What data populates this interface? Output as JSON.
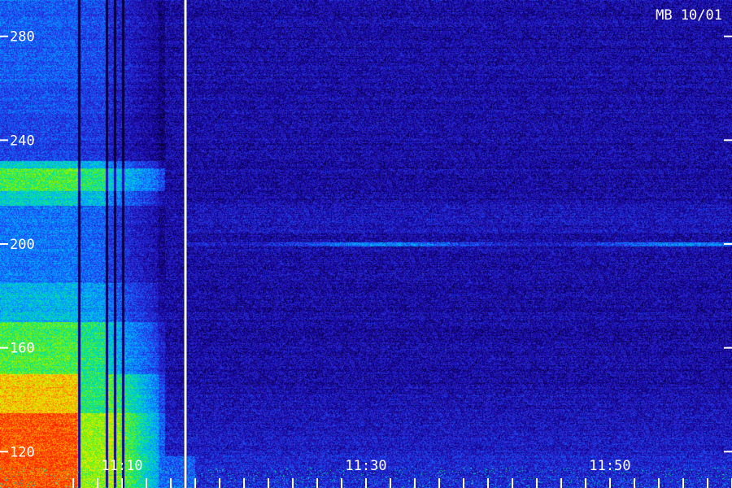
{
  "chart_data": {
    "type": "heatmap",
    "title": "MB 10/01",
    "xlabel": "",
    "ylabel": "",
    "y_ticks": [
      120,
      160,
      200,
      240,
      280
    ],
    "ylim": [
      106,
      294
    ],
    "x_tick_labels": [
      {
        "label": "11:10",
        "x_minutes": 10
      },
      {
        "label": "11:30",
        "x_minutes": 30
      },
      {
        "label": "11:50",
        "x_minutes": 50
      }
    ],
    "x_minor_tick_minutes": [
      6,
      8,
      10,
      12,
      14,
      16,
      18,
      20,
      22,
      24,
      26,
      28,
      30,
      32,
      34,
      36,
      38,
      40,
      42,
      44,
      46,
      48,
      50,
      52,
      54,
      56,
      58,
      60
    ],
    "data_gap_minute": 15.2,
    "colormap": [
      "#000010",
      "#12008a",
      "#2a1ecc",
      "#1460ff",
      "#00b4ff",
      "#00e890",
      "#7cf000",
      "#f0f000",
      "#ff8c00",
      "#ff1e00"
    ],
    "features": {
      "strong_band": {
        "x_minutes": [
          0,
          13
        ],
        "freq_range": [
          106,
          294
        ]
      },
      "band_at_200": {
        "freq": 200,
        "x_minutes": [
          15.2,
          60
        ]
      },
      "band_at_225": {
        "freq": 225,
        "x_minutes": [
          0,
          14
        ]
      }
    }
  }
}
